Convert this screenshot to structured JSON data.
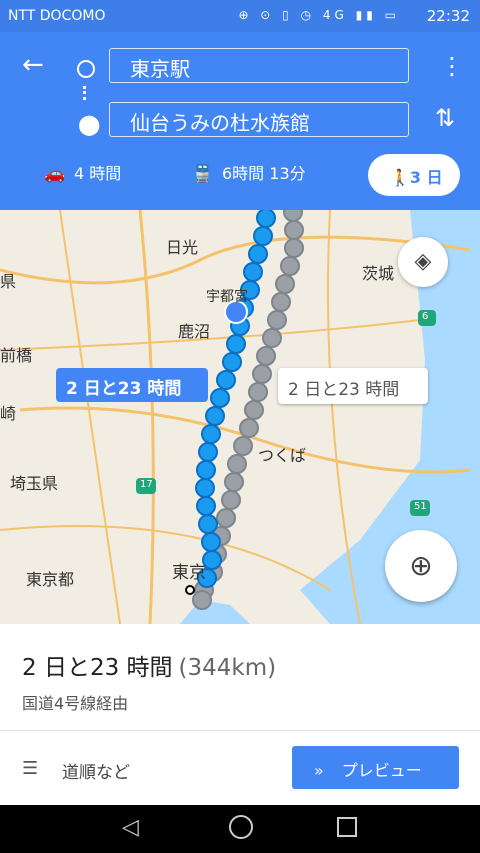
{
  "statusbar": {
    "carrier": "NTT DOCOMO",
    "icons": "⊕ ⊙ ▯ ◷ 4G ▮▮ ▭",
    "time": "22:32"
  },
  "header": {
    "back_icon": "←",
    "origin": "東京駅",
    "destination": "仙台うみの杜水族館",
    "menu_icon": "⋮",
    "swap_icon": "⇅",
    "modes": [
      {
        "icon": "car-icon",
        "glyph": "🚗",
        "label": "4 時間"
      },
      {
        "icon": "train-icon",
        "glyph": "🚆",
        "label": "6時間 13分"
      },
      {
        "icon": "walk-icon",
        "glyph": "🚶",
        "label": "3 日"
      }
    ]
  },
  "map": {
    "labels": [
      {
        "text": "日光"
      },
      {
        "text": "茨城"
      },
      {
        "text": "宇都宮"
      },
      {
        "text": "鹿沼"
      },
      {
        "text": "前橋"
      },
      {
        "text": "崎"
      },
      {
        "text": "つくば"
      },
      {
        "text": "埼玉県"
      },
      {
        "text": "東京都"
      },
      {
        "text": "東京"
      },
      {
        "text": "県"
      }
    ],
    "route_labels": {
      "primary": "2 日と23 時間",
      "alternative": "2 日と23 時間"
    },
    "road_numbers": [
      "6",
      "17",
      "51"
    ],
    "layers_icon": "layers-icon",
    "locate_icon": "my-location-icon"
  },
  "summary": {
    "duration": "2 日と23 時間",
    "distance": "(344km)",
    "via": "国道4号線経由",
    "steps_label": "道順など",
    "preview_label": "プレビュー"
  },
  "colors": {
    "primary": "#4285f4",
    "alt_route": "#9aa0a6"
  }
}
